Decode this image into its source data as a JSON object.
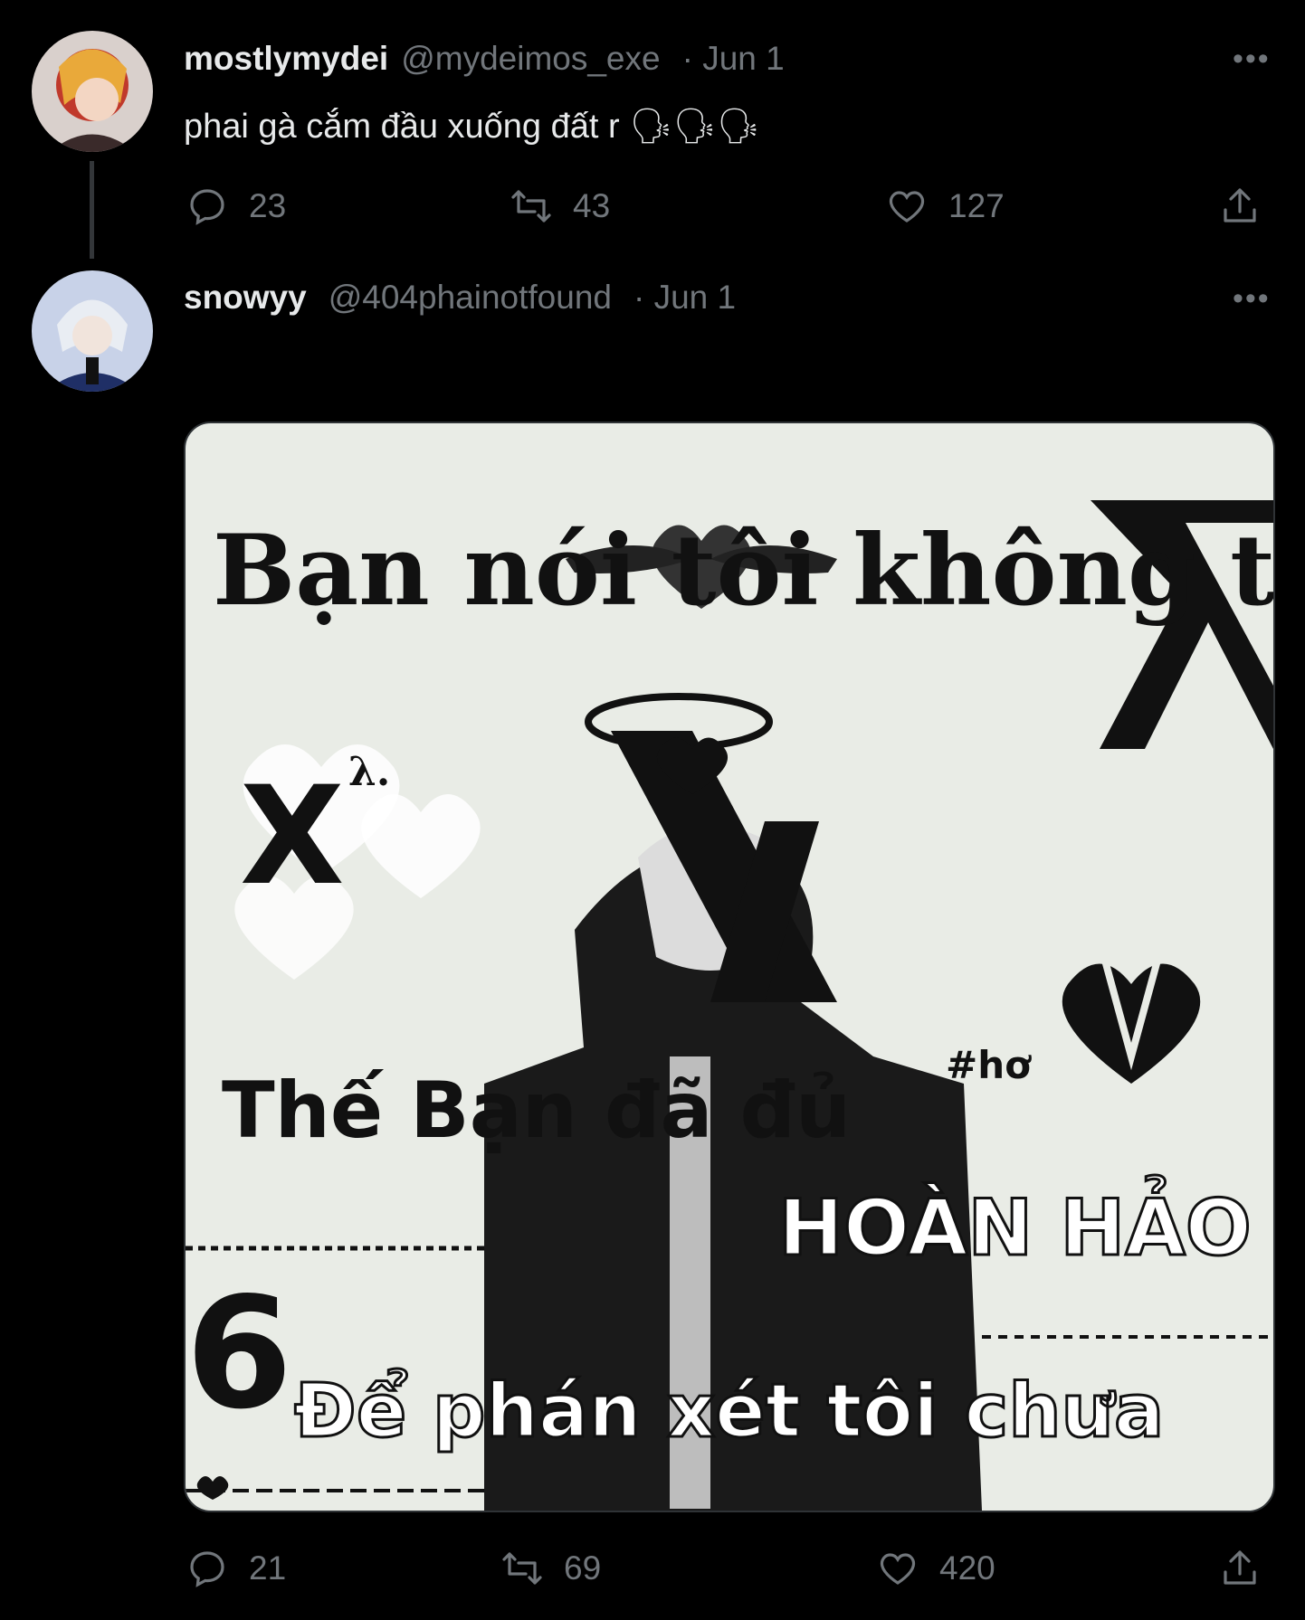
{
  "tweet1": {
    "display_name": "mostlymydei",
    "handle": "@mydeimos_exe",
    "date": "· Jun 1",
    "text": "phai gà cắm đầu xuống đất r 🗣🗣🗣",
    "replies": "23",
    "retweets": "43",
    "likes": "127"
  },
  "tweet2": {
    "display_name": "snowyy",
    "handle": "@404phainotfound",
    "date": "· Jun 1",
    "replies": "21",
    "retweets": "69",
    "likes": "420",
    "image": {
      "line1": "Bạn nói tôi không tốt",
      "line2": "Thế Bạn đã đủ",
      "line3": "HOÀN HẢO",
      "line4": "Để phán xét tôi chưa",
      "tag": "#hơ",
      "side_mark": "X",
      "side_sup": "λ.",
      "number": "6"
    }
  },
  "icons": {
    "more": "more-icon",
    "reply": "reply-icon",
    "retweet": "retweet-icon",
    "like": "like-icon",
    "share": "share-icon"
  },
  "colors": {
    "background": "#000000",
    "text": "#e7e9ea",
    "muted": "#71767b"
  }
}
